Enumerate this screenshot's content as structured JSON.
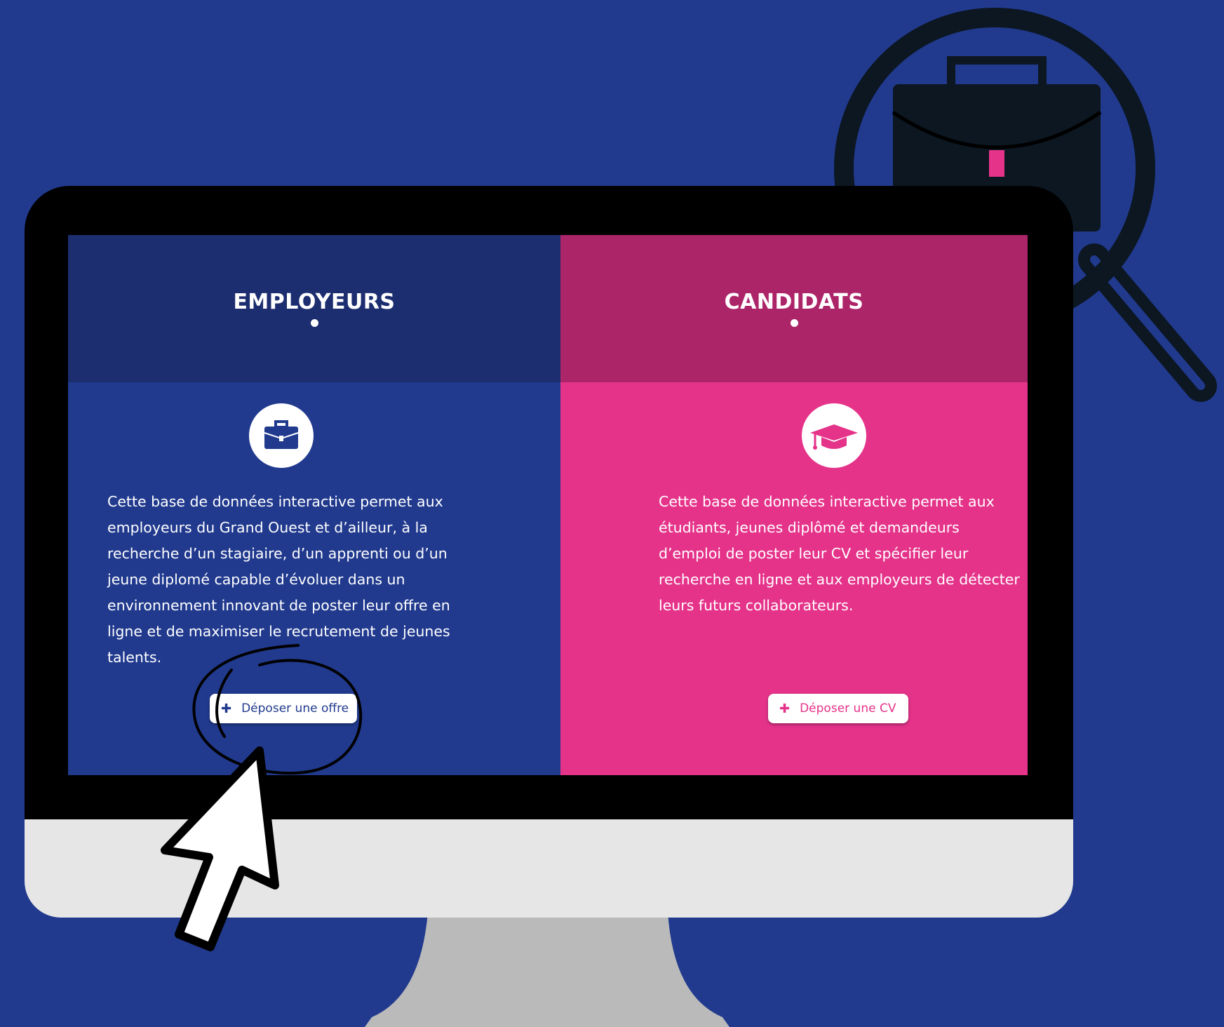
{
  "employeurs": {
    "title": "EMPLOYEURS",
    "icon": "briefcase-icon",
    "description": "Cette base de données interactive permet aux employeurs du Grand Ouest et d’ailleur, à la recherche d’un stagiaire, d’un apprenti ou d’un jeune diplomé capable d’évoluer dans un environnement innovant de poster leur offre en ligne et de maximiser le recrutement de jeunes talents.",
    "button_label": "Déposer une offre",
    "button_icon": "plus-icon"
  },
  "candidats": {
    "title": "CANDIDATS",
    "icon": "graduation-cap-icon",
    "description": "Cette base de données interactive permet aux étudiants, jeunes diplômé et demandeurs d’emploi de poster leur CV et spécifier leur recherche en ligne et aux employeurs de détecter leurs futurs collaborateurs.",
    "button_label": "Déposer une CV",
    "button_icon": "plus-icon"
  },
  "colors": {
    "background": "#213a8e",
    "employeurs_header": "#1c2d70",
    "employeurs_body": "#213a8e",
    "candidats_header": "#ad2569",
    "candidats_body": "#e5338a",
    "dark_navy": "#0c1722"
  },
  "decorations": {
    "magnifier": "magnifier-briefcase-icon",
    "cursor": "mouse-pointer-icon",
    "highlight": "hand-drawn-circle"
  }
}
